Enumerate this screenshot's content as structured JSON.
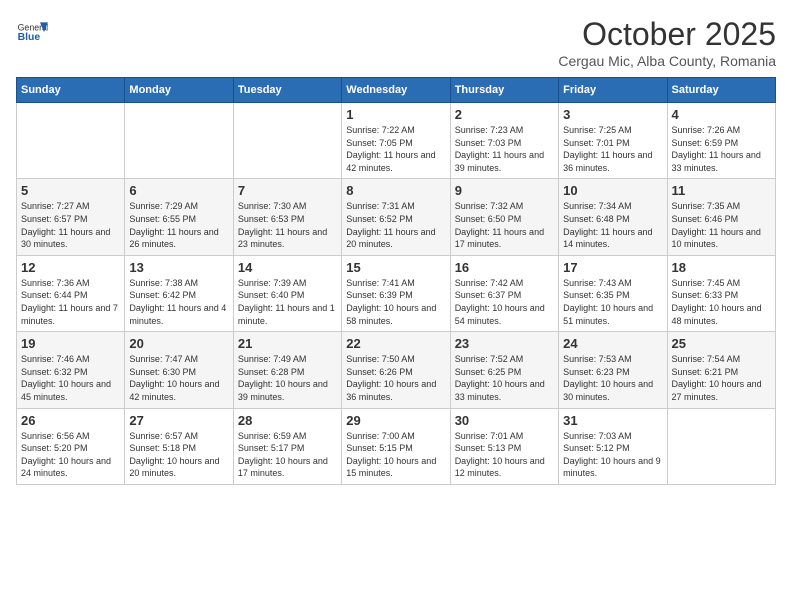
{
  "logo": {
    "general": "General",
    "blue": "Blue"
  },
  "title": "October 2025",
  "subtitle": "Cergau Mic, Alba County, Romania",
  "days_of_week": [
    "Sunday",
    "Monday",
    "Tuesday",
    "Wednesday",
    "Thursday",
    "Friday",
    "Saturday"
  ],
  "weeks": [
    [
      {
        "day": "",
        "sunrise": "",
        "sunset": "",
        "daylight": ""
      },
      {
        "day": "",
        "sunrise": "",
        "sunset": "",
        "daylight": ""
      },
      {
        "day": "",
        "sunrise": "",
        "sunset": "",
        "daylight": ""
      },
      {
        "day": "1",
        "sunrise": "Sunrise: 7:22 AM",
        "sunset": "Sunset: 7:05 PM",
        "daylight": "Daylight: 11 hours and 42 minutes."
      },
      {
        "day": "2",
        "sunrise": "Sunrise: 7:23 AM",
        "sunset": "Sunset: 7:03 PM",
        "daylight": "Daylight: 11 hours and 39 minutes."
      },
      {
        "day": "3",
        "sunrise": "Sunrise: 7:25 AM",
        "sunset": "Sunset: 7:01 PM",
        "daylight": "Daylight: 11 hours and 36 minutes."
      },
      {
        "day": "4",
        "sunrise": "Sunrise: 7:26 AM",
        "sunset": "Sunset: 6:59 PM",
        "daylight": "Daylight: 11 hours and 33 minutes."
      }
    ],
    [
      {
        "day": "5",
        "sunrise": "Sunrise: 7:27 AM",
        "sunset": "Sunset: 6:57 PM",
        "daylight": "Daylight: 11 hours and 30 minutes."
      },
      {
        "day": "6",
        "sunrise": "Sunrise: 7:29 AM",
        "sunset": "Sunset: 6:55 PM",
        "daylight": "Daylight: 11 hours and 26 minutes."
      },
      {
        "day": "7",
        "sunrise": "Sunrise: 7:30 AM",
        "sunset": "Sunset: 6:53 PM",
        "daylight": "Daylight: 11 hours and 23 minutes."
      },
      {
        "day": "8",
        "sunrise": "Sunrise: 7:31 AM",
        "sunset": "Sunset: 6:52 PM",
        "daylight": "Daylight: 11 hours and 20 minutes."
      },
      {
        "day": "9",
        "sunrise": "Sunrise: 7:32 AM",
        "sunset": "Sunset: 6:50 PM",
        "daylight": "Daylight: 11 hours and 17 minutes."
      },
      {
        "day": "10",
        "sunrise": "Sunrise: 7:34 AM",
        "sunset": "Sunset: 6:48 PM",
        "daylight": "Daylight: 11 hours and 14 minutes."
      },
      {
        "day": "11",
        "sunrise": "Sunrise: 7:35 AM",
        "sunset": "Sunset: 6:46 PM",
        "daylight": "Daylight: 11 hours and 10 minutes."
      }
    ],
    [
      {
        "day": "12",
        "sunrise": "Sunrise: 7:36 AM",
        "sunset": "Sunset: 6:44 PM",
        "daylight": "Daylight: 11 hours and 7 minutes."
      },
      {
        "day": "13",
        "sunrise": "Sunrise: 7:38 AM",
        "sunset": "Sunset: 6:42 PM",
        "daylight": "Daylight: 11 hours and 4 minutes."
      },
      {
        "day": "14",
        "sunrise": "Sunrise: 7:39 AM",
        "sunset": "Sunset: 6:40 PM",
        "daylight": "Daylight: 11 hours and 1 minute."
      },
      {
        "day": "15",
        "sunrise": "Sunrise: 7:41 AM",
        "sunset": "Sunset: 6:39 PM",
        "daylight": "Daylight: 10 hours and 58 minutes."
      },
      {
        "day": "16",
        "sunrise": "Sunrise: 7:42 AM",
        "sunset": "Sunset: 6:37 PM",
        "daylight": "Daylight: 10 hours and 54 minutes."
      },
      {
        "day": "17",
        "sunrise": "Sunrise: 7:43 AM",
        "sunset": "Sunset: 6:35 PM",
        "daylight": "Daylight: 10 hours and 51 minutes."
      },
      {
        "day": "18",
        "sunrise": "Sunrise: 7:45 AM",
        "sunset": "Sunset: 6:33 PM",
        "daylight": "Daylight: 10 hours and 48 minutes."
      }
    ],
    [
      {
        "day": "19",
        "sunrise": "Sunrise: 7:46 AM",
        "sunset": "Sunset: 6:32 PM",
        "daylight": "Daylight: 10 hours and 45 minutes."
      },
      {
        "day": "20",
        "sunrise": "Sunrise: 7:47 AM",
        "sunset": "Sunset: 6:30 PM",
        "daylight": "Daylight: 10 hours and 42 minutes."
      },
      {
        "day": "21",
        "sunrise": "Sunrise: 7:49 AM",
        "sunset": "Sunset: 6:28 PM",
        "daylight": "Daylight: 10 hours and 39 minutes."
      },
      {
        "day": "22",
        "sunrise": "Sunrise: 7:50 AM",
        "sunset": "Sunset: 6:26 PM",
        "daylight": "Daylight: 10 hours and 36 minutes."
      },
      {
        "day": "23",
        "sunrise": "Sunrise: 7:52 AM",
        "sunset": "Sunset: 6:25 PM",
        "daylight": "Daylight: 10 hours and 33 minutes."
      },
      {
        "day": "24",
        "sunrise": "Sunrise: 7:53 AM",
        "sunset": "Sunset: 6:23 PM",
        "daylight": "Daylight: 10 hours and 30 minutes."
      },
      {
        "day": "25",
        "sunrise": "Sunrise: 7:54 AM",
        "sunset": "Sunset: 6:21 PM",
        "daylight": "Daylight: 10 hours and 27 minutes."
      }
    ],
    [
      {
        "day": "26",
        "sunrise": "Sunrise: 6:56 AM",
        "sunset": "Sunset: 5:20 PM",
        "daylight": "Daylight: 10 hours and 24 minutes."
      },
      {
        "day": "27",
        "sunrise": "Sunrise: 6:57 AM",
        "sunset": "Sunset: 5:18 PM",
        "daylight": "Daylight: 10 hours and 20 minutes."
      },
      {
        "day": "28",
        "sunrise": "Sunrise: 6:59 AM",
        "sunset": "Sunset: 5:17 PM",
        "daylight": "Daylight: 10 hours and 17 minutes."
      },
      {
        "day": "29",
        "sunrise": "Sunrise: 7:00 AM",
        "sunset": "Sunset: 5:15 PM",
        "daylight": "Daylight: 10 hours and 15 minutes."
      },
      {
        "day": "30",
        "sunrise": "Sunrise: 7:01 AM",
        "sunset": "Sunset: 5:13 PM",
        "daylight": "Daylight: 10 hours and 12 minutes."
      },
      {
        "day": "31",
        "sunrise": "Sunrise: 7:03 AM",
        "sunset": "Sunset: 5:12 PM",
        "daylight": "Daylight: 10 hours and 9 minutes."
      },
      {
        "day": "",
        "sunrise": "",
        "sunset": "",
        "daylight": ""
      }
    ]
  ]
}
